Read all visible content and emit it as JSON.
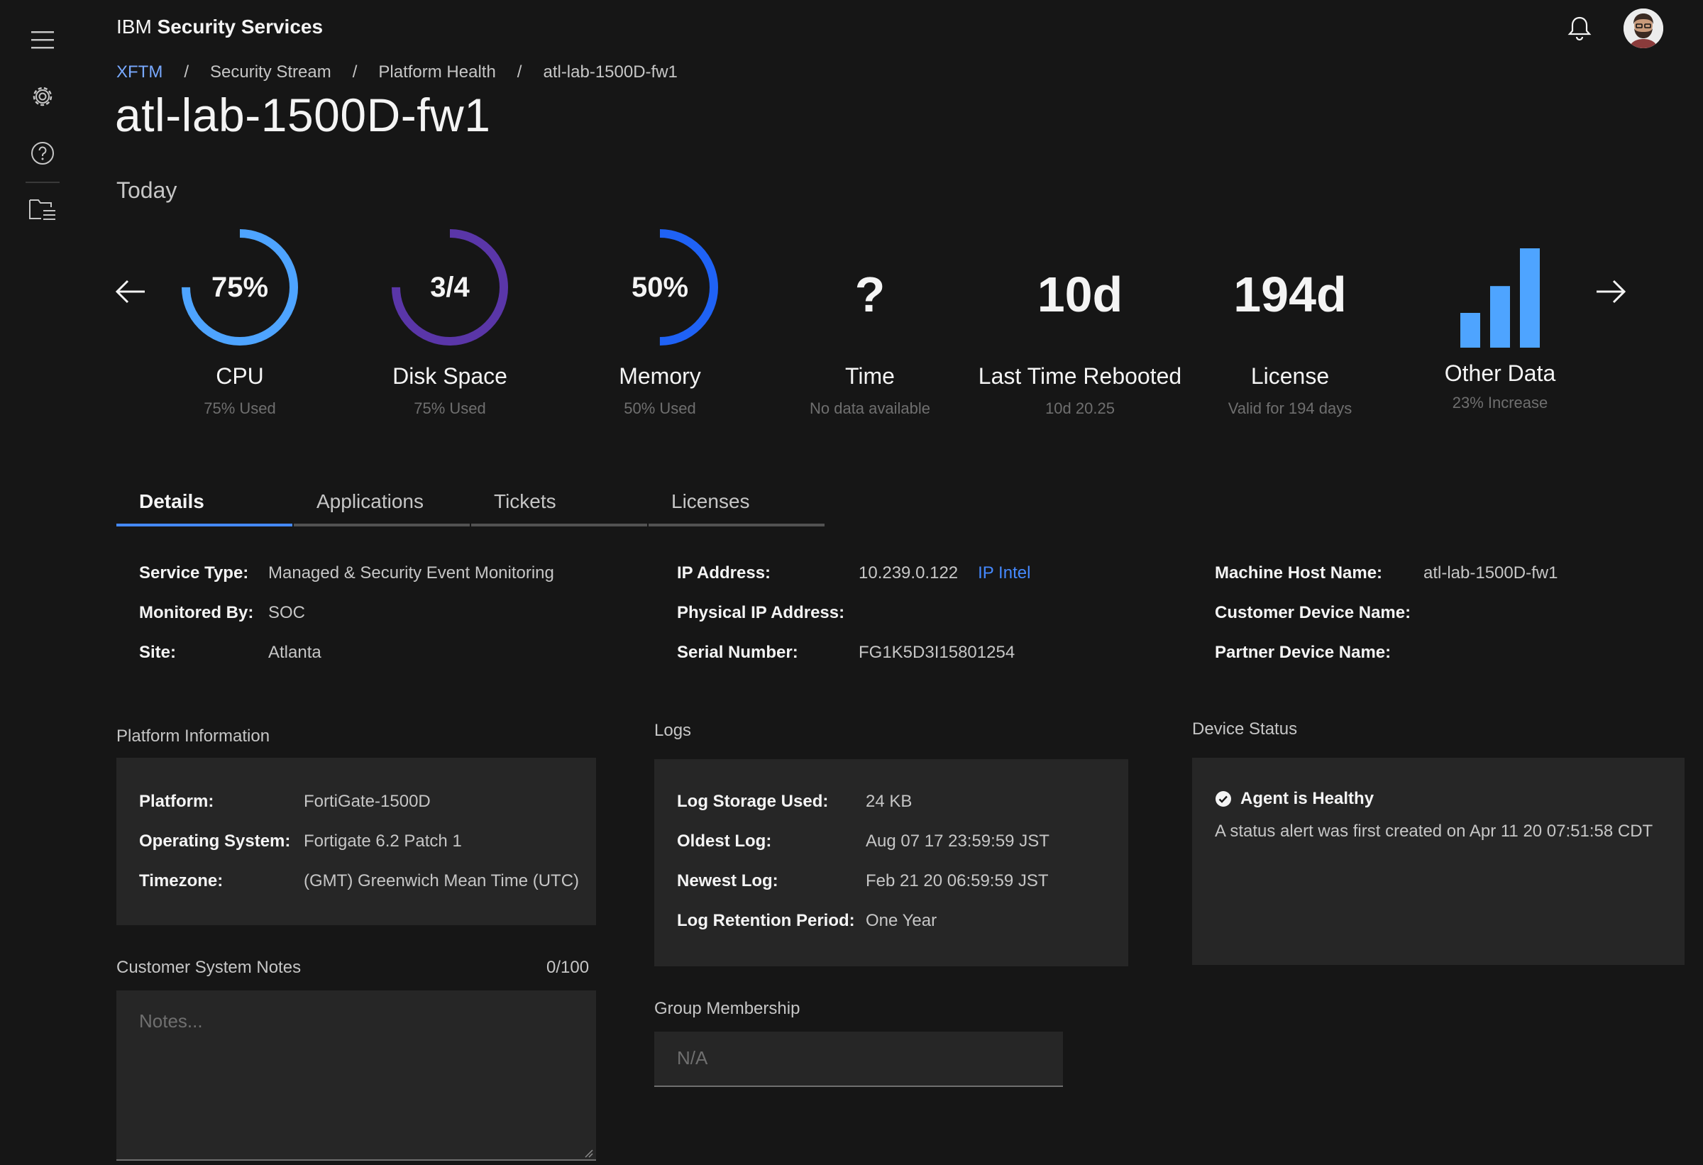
{
  "header": {
    "brand_prefix": "IBM",
    "brand_name": "Security Services"
  },
  "rail": {
    "icons": [
      "menu-icon",
      "gear-icon",
      "help-icon",
      "folder-list-icon"
    ]
  },
  "breadcrumb": [
    "XFTM",
    "Security Stream",
    "Platform Health",
    "atl-lab-1500D-fw1"
  ],
  "page_title": "atl-lab-1500D-fw1",
  "period_label": "Today",
  "metrics": [
    {
      "kind": "ring",
      "value": "75%",
      "fraction": 0.75,
      "color": "#4ea4ff",
      "label": "CPU",
      "sub": "75% Used"
    },
    {
      "kind": "ring",
      "value": "3/4",
      "fraction": 0.75,
      "color": "#5a36a8",
      "label": "Disk Space",
      "sub": "75% Used"
    },
    {
      "kind": "ring",
      "value": "50%",
      "fraction": 0.5,
      "color": "#1f62f5",
      "label": "Memory",
      "sub": "50% Used"
    },
    {
      "kind": "text",
      "value": "?",
      "label": "Time",
      "sub": "No data available"
    },
    {
      "kind": "text",
      "value": "10d",
      "label": "Last Time Rebooted",
      "sub": "10d 20.25"
    },
    {
      "kind": "text",
      "value": "194d",
      "label": "License",
      "sub": "Valid for 194 days"
    },
    {
      "kind": "bars",
      "bars": [
        0.35,
        0.62,
        1.0
      ],
      "color": "#4ea4ff",
      "label": "Other Data",
      "sub": "23% Increase"
    }
  ],
  "tabs": [
    {
      "label": "Details",
      "active": true
    },
    {
      "label": "Applications",
      "active": false
    },
    {
      "label": "Tickets",
      "active": false
    },
    {
      "label": "Licenses",
      "active": false
    }
  ],
  "details": {
    "col1": [
      {
        "k": "Service Type:",
        "v": "Managed & Security Event Monitoring"
      },
      {
        "k": "Monitored By:",
        "v": "SOC"
      },
      {
        "k": "Site:",
        "v": "Atlanta"
      }
    ],
    "col2": [
      {
        "k": "IP Address:",
        "v": "10.239.0.122",
        "link": "IP Intel"
      },
      {
        "k": "Physical IP Address:",
        "v": ""
      },
      {
        "k": "Serial Number:",
        "v": "FG1K5D3I15801254"
      }
    ],
    "col3": [
      {
        "k": "Machine Host Name:",
        "v": "atl-lab-1500D-fw1"
      },
      {
        "k": "Customer Device Name:",
        "v": ""
      },
      {
        "k": "Partner Device Name:",
        "v": ""
      }
    ]
  },
  "platform": {
    "title": "Platform Information",
    "rows": [
      {
        "k": "Platform:",
        "v": "FortiGate-1500D"
      },
      {
        "k": "Operating System:",
        "v": "Fortigate 6.2 Patch 1"
      },
      {
        "k": "Timezone:",
        "v": "(GMT) Greenwich Mean Time (UTC)"
      }
    ]
  },
  "logs": {
    "title": "Logs",
    "rows": [
      {
        "k": "Log Storage Used:",
        "v": "24 KB"
      },
      {
        "k": "Oldest Log:",
        "v": "Aug 07 17 23:59:59 JST"
      },
      {
        "k": "Newest Log:",
        "v": "Feb 21 20 06:59:59 JST"
      },
      {
        "k": "Log Retention Period:",
        "v": "One Year"
      }
    ]
  },
  "device_status": {
    "title": "Device Status",
    "headline": "Agent is Healthy",
    "description": "A status alert was first created on Apr 11 20 07:51:58 CDT"
  },
  "notes": {
    "title": "Customer System Notes",
    "counter": "0/100",
    "placeholder": "Notes..."
  },
  "group": {
    "title": "Group Membership",
    "value": "N/A"
  }
}
